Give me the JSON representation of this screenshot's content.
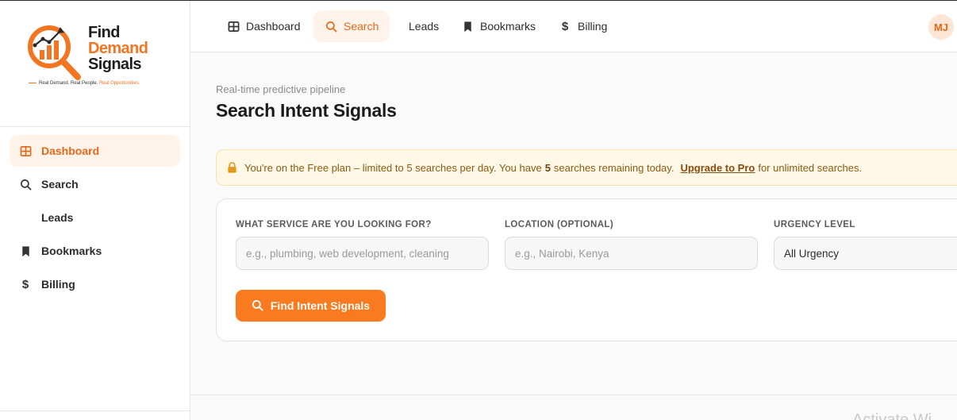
{
  "brand": {
    "line1": "Find",
    "line2": "Demand",
    "line3": "Signals",
    "tagline_part1": "Real Demand. Real People.",
    "tagline_part2": "Real Opportunities.",
    "accent_color": "#f37521"
  },
  "sidebar": {
    "items": [
      {
        "label": "Dashboard",
        "icon": "grid-icon",
        "active": true
      },
      {
        "label": "Search",
        "icon": "search-icon",
        "active": false
      },
      {
        "label": "Leads",
        "icon": "",
        "active": false
      },
      {
        "label": "Bookmarks",
        "icon": "bookmark-icon",
        "active": false
      },
      {
        "label": "Billing",
        "icon": "dollar-icon",
        "active": false
      }
    ]
  },
  "topnav": {
    "items": [
      {
        "label": "Dashboard",
        "icon": "grid-icon",
        "active": false
      },
      {
        "label": "Search",
        "icon": "search-icon",
        "active": true
      },
      {
        "label": "Leads",
        "icon": "",
        "active": false
      },
      {
        "label": "Bookmarks",
        "icon": "bookmark-icon",
        "active": false
      },
      {
        "label": "Billing",
        "icon": "dollar-icon",
        "active": false
      }
    ],
    "avatar_initials": "MJ"
  },
  "page": {
    "subtitle": "Real-time predictive pipeline",
    "title": "Search Intent Signals"
  },
  "notice": {
    "text_before": "You're on the Free plan – limited to 5 searches per day. You have",
    "remaining": "5",
    "text_middle": "searches remaining today.",
    "upgrade_label": "Upgrade to Pro",
    "text_after": "for unlimited searches.",
    "icon": "lock-icon"
  },
  "form": {
    "service_label": "WHAT SERVICE ARE YOU LOOKING FOR?",
    "service_placeholder": "e.g., plumbing, web development, cleaning",
    "location_label": "LOCATION (OPTIONAL)",
    "location_placeholder": "e.g., Nairobi, Kenya",
    "urgency_label": "URGENCY LEVEL",
    "urgency_value": "All Urgency",
    "submit_label": "Find Intent Signals"
  },
  "watermark": "Activate Wi"
}
